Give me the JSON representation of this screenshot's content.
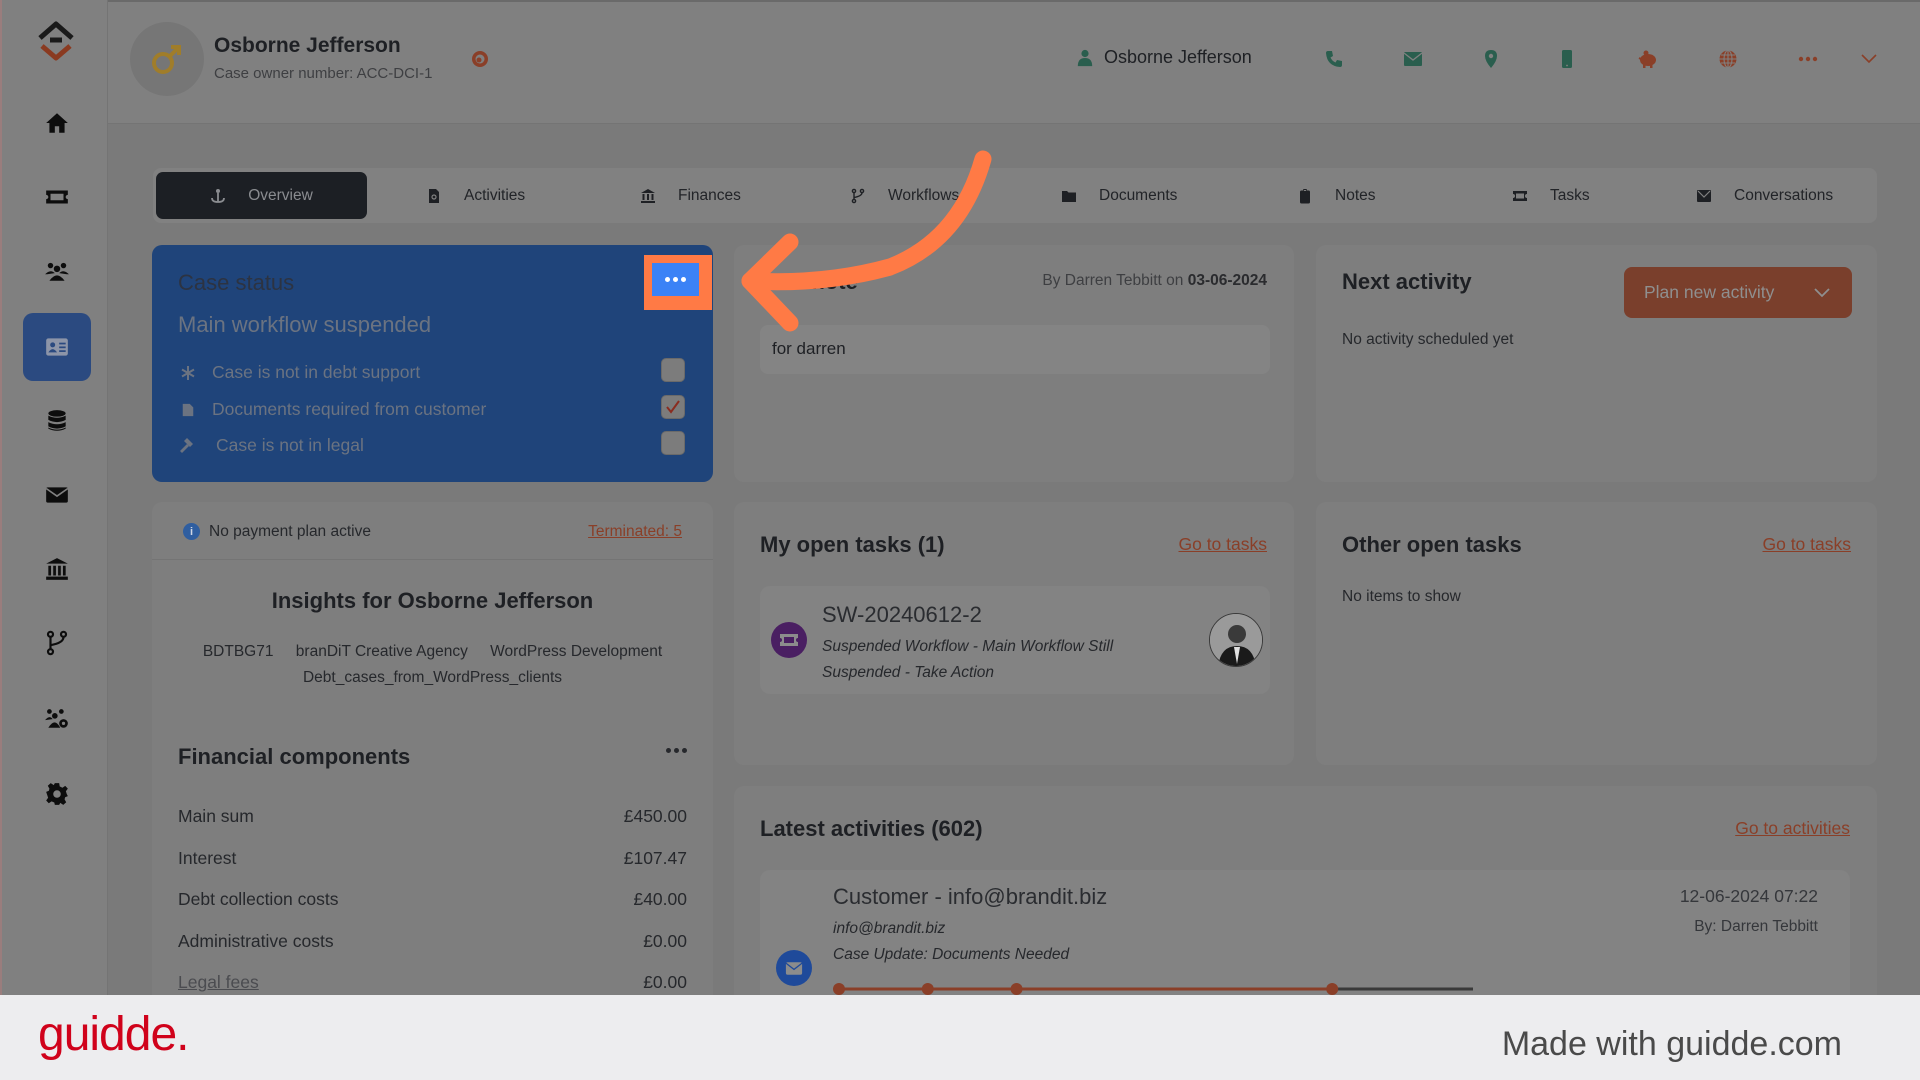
{
  "sidebar": {
    "items": [
      {
        "name": "home",
        "icon": "home-icon",
        "active": false
      },
      {
        "name": "tickets",
        "icon": "ticket-icon",
        "active": false
      },
      {
        "name": "users",
        "icon": "users-icon",
        "active": false
      },
      {
        "name": "cases",
        "icon": "id-card-icon",
        "active": true
      },
      {
        "name": "database",
        "icon": "database-icon",
        "active": false
      },
      {
        "name": "mail",
        "icon": "envelope-icon",
        "active": false
      },
      {
        "name": "finances",
        "icon": "bank-icon",
        "active": false
      },
      {
        "name": "workflows",
        "icon": "branch-icon",
        "active": false
      },
      {
        "name": "user-settings",
        "icon": "users-gear-icon",
        "active": false
      },
      {
        "name": "settings",
        "icon": "gear-icon",
        "active": false
      }
    ]
  },
  "header": {
    "owner_name": "Osborne Jefferson",
    "owner_sub": "Case owner number: ACC-DCI-1",
    "contact_name": "Osborne Jefferson",
    "icons": [
      "phone-icon",
      "envelope-icon",
      "location-pin-icon",
      "mobile-icon",
      "piggy-bank-icon",
      "globe-icon",
      "more-icon",
      "chevron-down-icon"
    ]
  },
  "tabs": [
    {
      "label": "Overview",
      "icon": "anchor-icon",
      "active": true
    },
    {
      "label": "Activities",
      "icon": "file-search-icon"
    },
    {
      "label": "Finances",
      "icon": "bank-icon"
    },
    {
      "label": "Workflows",
      "icon": "branch-icon"
    },
    {
      "label": "Documents",
      "icon": "folder-icon"
    },
    {
      "label": "Notes",
      "icon": "clipboard-icon"
    },
    {
      "label": "Tasks",
      "icon": "ticket-icon"
    },
    {
      "label": "Conversations",
      "icon": "envelope-icon"
    }
  ],
  "case_status": {
    "title": "Case status",
    "status": "Main workflow suspended",
    "flags": [
      {
        "label": "Case is not in debt support",
        "icon": "asterisk-icon",
        "checked": false
      },
      {
        "label": "Documents required from customer",
        "icon": "file-icon",
        "checked": true
      },
      {
        "label": "Case is not in legal",
        "icon": "gavel-icon",
        "checked": false
      }
    ]
  },
  "note": {
    "title": "Last note",
    "meta_prefix": "By Darren Tebbitt on",
    "meta_date": "03-06-2024",
    "body": "for darren"
  },
  "next_activity": {
    "title": "Next activity",
    "button": "Plan new activity",
    "empty": "No activity scheduled yet"
  },
  "payment": {
    "text": "No payment plan active",
    "terminated": "Terminated: 5"
  },
  "insights": {
    "title": "Insights for Osborne Jefferson",
    "tags": [
      "BDTBG71",
      "branDiT Creative Agency",
      "WordPress Development",
      "Debt_cases_from_WordPress_clients"
    ]
  },
  "financial": {
    "title": "Financial components",
    "rows": [
      {
        "label": "Main sum",
        "value": "£450.00"
      },
      {
        "label": "Interest",
        "value": "£107.47"
      },
      {
        "label": "Debt collection costs",
        "value": "£40.00"
      },
      {
        "label": "Administrative costs",
        "value": "£0.00"
      },
      {
        "label": "Legal fees",
        "value": "£0.00"
      }
    ]
  },
  "my_tasks": {
    "title": "My open tasks (1)",
    "link": "Go to tasks",
    "items": [
      {
        "id": "SW-20240612-2",
        "desc": "Suspended Workflow - Main Workflow Still Suspended - Take Action"
      }
    ]
  },
  "other_tasks": {
    "title": "Other open tasks",
    "link": "Go to tasks",
    "empty": "No items to show"
  },
  "latest": {
    "title": "Latest activities (602)",
    "link": "Go to activities",
    "items": [
      {
        "title": "Customer - info@brandit.biz",
        "email": "info@brandit.biz",
        "subject": "Case Update: Documents Needed",
        "date": "12-06-2024 07:22",
        "by": "By: Darren Tebbitt",
        "progress_steps_done": 4,
        "progress_fraction": 0.78
      }
    ]
  },
  "footer": {
    "brand": "guidde.",
    "made_with": "Made with guidde.com"
  },
  "colors": {
    "accent": "#ff7a45",
    "highlight_button": "#3b82f6",
    "case_status_bg": "#1f447a",
    "brand": "#d0021b"
  }
}
